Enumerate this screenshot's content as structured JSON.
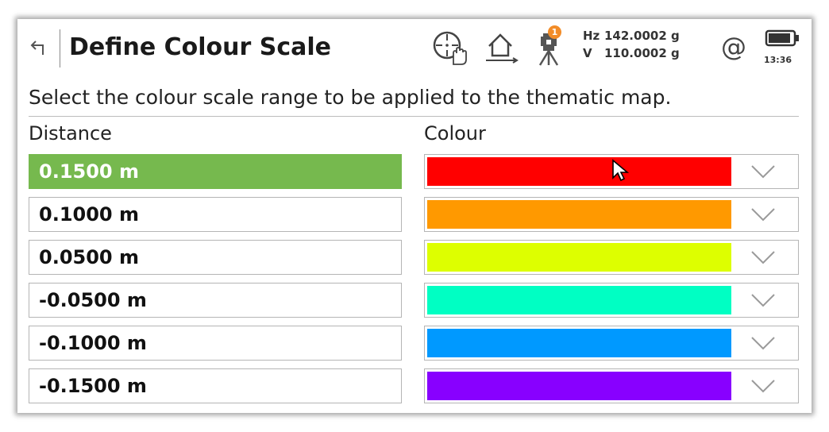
{
  "header": {
    "title": "Define Colour Scale",
    "icons": [
      "back-arrow-icon",
      "target-hand-icon",
      "home-icon",
      "instrument-icon",
      "at-icon",
      "battery-icon"
    ],
    "notification_count": "1",
    "hz_label": "Hz",
    "hz_value": "142.0002 g",
    "v_label": "V",
    "v_value": "110.0002 g",
    "time": "13:36"
  },
  "instruction": "Select the colour scale range to be applied to the thematic map.",
  "table": {
    "col_distance": "Distance",
    "col_colour": "Colour",
    "rows": [
      {
        "distance": "0.1500 m",
        "colour": "#ff0000",
        "selected": true
      },
      {
        "distance": "0.1000 m",
        "colour": "#ff9900",
        "selected": false
      },
      {
        "distance": "0.0500 m",
        "colour": "#ddff00",
        "selected": false
      },
      {
        "distance": "-0.0500 m",
        "colour": "#00ffc3",
        "selected": false
      },
      {
        "distance": "-0.1000 m",
        "colour": "#0099ff",
        "selected": false
      },
      {
        "distance": "-0.1500 m",
        "colour": "#8800ff",
        "selected": false
      }
    ]
  },
  "colors": {
    "selected_row": "#76b94e",
    "badge": "#f28c28"
  }
}
